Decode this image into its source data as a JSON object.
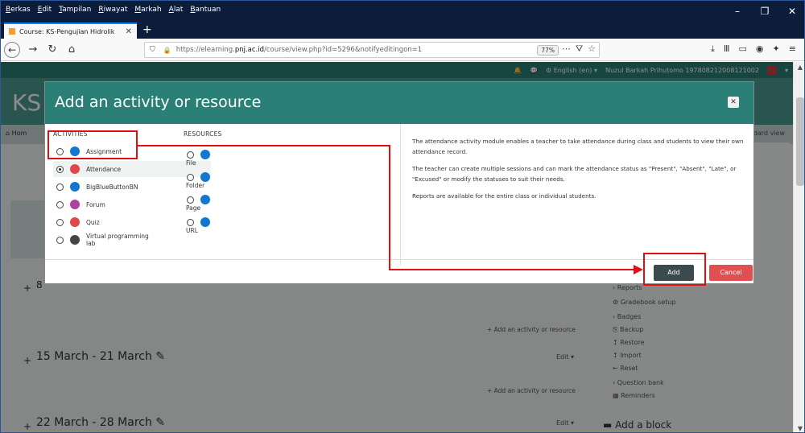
{
  "browser": {
    "menus": [
      "Berkas",
      "Edit",
      "Tampilan",
      "Riwayat",
      "Markah",
      "Alat",
      "Bantuan"
    ],
    "tab_title": "Course: KS-Pengujian Hidrolik",
    "url_prefix": "https://elearning.",
    "url_domain": "pnj.ac.id",
    "url_path": "/course/view.php?id=5296&notifyeditingon=1",
    "zoom": "77%"
  },
  "moodle": {
    "top_language": "English (en)",
    "top_user": "Nuzul Barkah Prihutomo 197808212008121002",
    "course_short": "KS",
    "home_crumb": "Hom",
    "standard_view": "ndard view",
    "weeks": [
      {
        "title": "15 March - 21 March",
        "edit": "Edit",
        "add": "Add an activity or resource"
      },
      {
        "title": "22 March - 28 March",
        "edit": "Edit",
        "add": "Add an activity or resource"
      }
    ],
    "prev_add": "Add an activity or resource",
    "week_num_partial": "8",
    "admin_items": [
      "Reports",
      "Gradebook setup",
      "Badges",
      "Backup",
      "Restore",
      "Import",
      "Reset",
      "Question bank",
      "Reminders"
    ],
    "add_block": "Add a block"
  },
  "modal": {
    "title": "Add an activity or resource",
    "activities_header": "ACTIVITIES",
    "resources_header": "RESOURCES",
    "activities": [
      {
        "label": "Assignment",
        "color": "#1177d1",
        "selected": false
      },
      {
        "label": "Attendance",
        "color": "#e04848",
        "selected": true
      },
      {
        "label": "BigBlueButtonBN",
        "color": "#1177d1",
        "selected": false
      },
      {
        "label": "Forum",
        "color": "#b040a0",
        "selected": false
      },
      {
        "label": "Quiz",
        "color": "#e04848",
        "selected": false
      },
      {
        "label": "Virtual programming lab",
        "color": "#444444",
        "selected": false
      }
    ],
    "resources": [
      {
        "label": "File"
      },
      {
        "label": "Folder"
      },
      {
        "label": "Page"
      },
      {
        "label": "URL"
      }
    ],
    "description": [
      "The attendance activity module enables a teacher to take attendance during class and students to view their own attendance record.",
      "The teacher can create multiple sessions and can mark the attendance status as \"Present\", \"Absent\", \"Late\", or \"Excused\" or modify the statuses to suit their needs.",
      "Reports are available for the entire class or individual students."
    ],
    "add_label": "Add",
    "cancel_label": "Cancel"
  },
  "annotation_color": "#e01010"
}
